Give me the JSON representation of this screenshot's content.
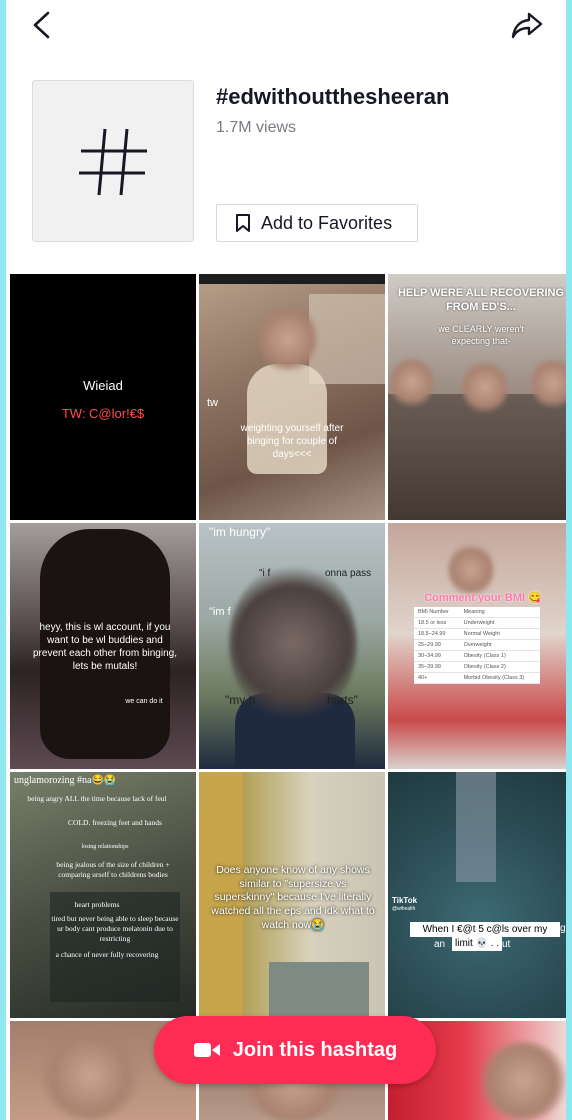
{
  "topbar": {
    "back_icon": "chevron-left-icon",
    "share_icon": "share-arrow-icon"
  },
  "header": {
    "hashtag_symbol": "#",
    "title": "#edwithoutthesheeran",
    "views": "1.7M views",
    "favorite_label": "Add to Favorites",
    "favorite_icon": "bookmark-icon"
  },
  "videos": [
    {
      "title": "Wieiad",
      "subtitle": "TW: C@lor!€$"
    },
    {
      "caption": "weighting yourself after binging for couple of days<<<",
      "tag": "tw"
    },
    {
      "banner": "HELP WERE ALL RECOVERING FROM ED'S...",
      "caption": "we CLEARLY weren't expecting that-"
    },
    {
      "caption": "heyy, this is wl account, if you want to be wl buddies and prevent each other from binging, lets be mutals!",
      "small": "we can do it"
    },
    {
      "top": "\"im hungry\"",
      "line1": "\"i f",
      "line1b": "onna pass",
      "line2": "\"im f",
      "line3": "\"my h",
      "line3b": "hurts\""
    },
    {
      "banner": "Comment your BMI 😋",
      "table": [
        [
          "BMI Number",
          "Meaning"
        ],
        [
          "18.5 or less",
          "Underweight"
        ],
        [
          "18.5–24.99",
          "Normal Weight"
        ],
        [
          "25–29.99",
          "Overweight"
        ],
        [
          "30–34.99",
          "Obesity (Class 1)"
        ],
        [
          "35–39.99",
          "Obesity (Class 2)"
        ],
        [
          "40+",
          "Morbid Obesity (Class 3)"
        ]
      ]
    },
    {
      "heading": "unglamorozing #na😂😭",
      "items": [
        "being angry ALL the time because lack of feul",
        "COLD. freezing feet and hands",
        "losing relationships",
        "being jealous of the size of children + comparing urself to childrens bodies",
        "heart problems",
        "tired but never being able to sleep because ur body cant produce melatonin due to restricting",
        "a chance of never fully recovering"
      ]
    },
    {
      "caption": "Does anyone know of any shows similar to \"supersize vs superskinny\" because I've literally watched all the eps and idk what to watch now😭"
    },
    {
      "caption": "When I €@t 5 c@ls over my",
      "caption2": "an",
      "caption2b": "limit 💀 . .",
      "caption2c": "ut",
      "caption2d": "g",
      "brand": "TikTok",
      "handle": "@wlhealth"
    }
  ],
  "join": {
    "label": "Join this hashtag",
    "icon": "video-camera-icon"
  },
  "colors": {
    "accent": "#fe2c55",
    "frame": "#8fe8ef"
  }
}
